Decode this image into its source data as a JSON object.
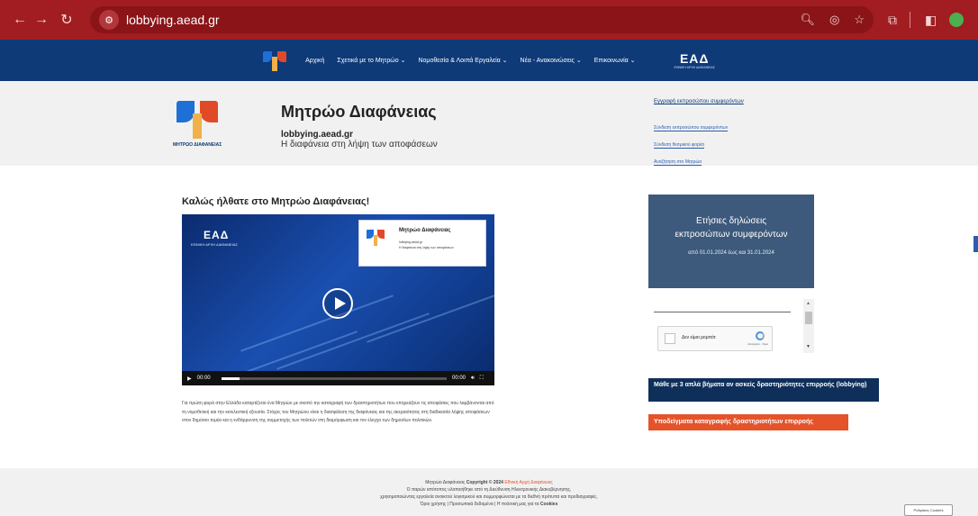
{
  "browser": {
    "url": "lobbying.aead.gr"
  },
  "nav": {
    "items": [
      {
        "label": "Αρχική"
      },
      {
        "label": "Σχετικά με το Μητρώο ⌄"
      },
      {
        "label": "Νομοθεσία & Λοιπά Εργαλεία ⌄"
      },
      {
        "label": "Νέα - Ανακοινώσεις ⌄"
      },
      {
        "label": "Επικοινωνία ⌄"
      }
    ],
    "eada_mark": "ΕΑΔ",
    "eada_caption": "ΕΘΝΙΚΗ ΑΡΧΗ ΔΙΑΦΑΝΕΙΑΣ"
  },
  "header": {
    "logo_caption": "ΜΗΤΡΩΟ ΔΙΑΦΑΝΕΙΑΣ",
    "title": "Μητρώο Διαφάνειας",
    "domain": "lobbying.aead.gr",
    "tagline": "Η διαφάνεια στη λήψη των αποφάσεων",
    "links": {
      "register": "Εγγραφή εκπροσώπου συμφερόντων",
      "login_rep": "Σύνδεση εκπροσώπου συμφερόντων",
      "login_inst": "Σύνδεση θεσμικού φορέα",
      "search": "Αναζήτηση στο Μητρώο"
    }
  },
  "main": {
    "welcome": "Καλώς ήλθατε στο Μητρώο Διαφάνειας!",
    "video": {
      "logo_mark": "ΕΑΔ",
      "logo_caption": "ΕΘΝΙΚΗ ΑΡΧΗ ΔΙΑΦΑΝΕΙΑΣ",
      "card_title": "Μητρώο Διαφάνειας",
      "card_domain": "lobbying.aead.gr",
      "card_tagline": "Η διαφάνεια στη λήψη των αποφάσεων",
      "time_current": "00:00",
      "time_total": "00:00",
      "progress": 0.08
    },
    "paragraph": "Για πρώτη φορά στην Ελλάδα καταρτίζεται ένα Μητρώο με σκοπό την καταγραφή των δραστηριοτήτων που επηρεάζουν τις αποφάσεις που λαμβάνονται από τη νομοθετική και την εκτελεστική εξουσία. Στόχος του Μητρώου είναι η διασφάλιση της διαφάνειας και της ακεραιότητας στη διαδικασία λήψης αποφάσεων στον δημόσιο τομέα και η ενθάρρυνση της συμμετοχής των πολιτών στη διαμόρφωση και τον έλεγχο των δημοσίων πολιτικών."
  },
  "sidebar": {
    "annual_title_1": "Ετήσιες δηλώσεις",
    "annual_title_2": "εκπροσώπων συμφερόντων",
    "annual_dates": "από 01.01.2024 έως και 31.01.2024",
    "recaptcha_label": "Δεν είμαι ρομπότ",
    "recaptcha_privacy": "Απόρρητο - Όροι",
    "steps_button": "Μάθε με 3 απλά βήματα αν ασκείς δραστηριότητες επιρροής (lobbying)",
    "samples_button": "Υποδείγματα καταγραφής δραστηριοτήτων επιρροής"
  },
  "footer": {
    "line1_prefix": "Μητρώο Διαφάνειας ",
    "line1_copyright": "Copyright © 2024",
    "line1_link": " Εθνική Αρχή Διαφάνειας",
    "line2": "Ο παρών ιστότοπος υλοποιήθηκε από τη Διεύθυνση Ηλεκτρονικής Διακυβέρνησης,",
    "line3": "χρησιμοποιώντας εργαλεία ανοικτού λογισμικού και συμμορφώνεται με τα διεθνή πρότυπα και προδιαγραφές.",
    "line4_prefix": "Όροι χρήσης | Προσωπικά δεδομένα | Η πολιτική μας για τα ",
    "line4_cookies": "Cookies",
    "cookie_button": "Ρυθμίσεις Cookies"
  },
  "colors": {
    "browser_bar": "#a11d21",
    "site_nav": "#0e3a78",
    "annual_box": "#3d5a7c",
    "steps_button": "#0e2f5a",
    "samples_button": "#e5532a"
  }
}
